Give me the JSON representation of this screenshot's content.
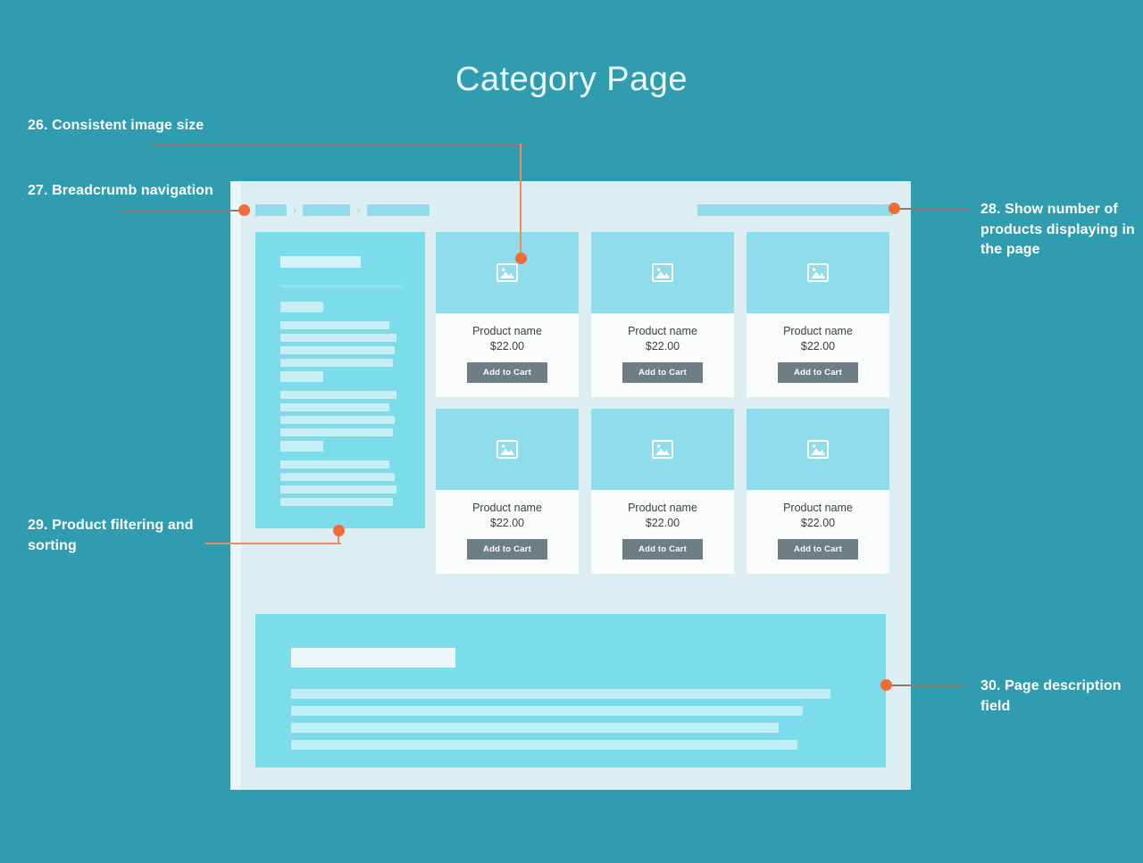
{
  "page": {
    "title": "Category Page",
    "background_color": "#309cb0",
    "accent_color": "#f26c35",
    "wireframe_bg": "#ddeef2",
    "panel_blue": "#7cdcea",
    "light_blue": "#8fdcea"
  },
  "topbar": {
    "breadcrumb": {
      "name": "breadcrumb-navigation",
      "separator": "›",
      "items": [
        "",
        "",
        ""
      ]
    },
    "product_count_bar": {
      "name": "product-count-bar",
      "value": ""
    }
  },
  "sidebar": {
    "name": "product-filter-sort-panel",
    "title_placeholder": "",
    "groups": [
      {
        "heading": "",
        "lines": [
          "",
          "",
          "",
          ""
        ]
      },
      {
        "heading": "",
        "lines": [
          "",
          "",
          "",
          ""
        ]
      },
      {
        "heading": "",
        "lines": [
          "",
          "",
          "",
          ""
        ]
      }
    ]
  },
  "products": {
    "icon_name": "image-placeholder-icon",
    "add_to_cart_label": "Add to Cart",
    "items": [
      {
        "name": "Product name",
        "price": "$22.00"
      },
      {
        "name": "Product name",
        "price": "$22.00"
      },
      {
        "name": "Product name",
        "price": "$22.00"
      },
      {
        "name": "Product name",
        "price": "$22.00"
      },
      {
        "name": "Product name",
        "price": "$22.00"
      },
      {
        "name": "Product name",
        "price": "$22.00"
      }
    ]
  },
  "description_field": {
    "name": "page-description-field",
    "title_placeholder": "",
    "lines": [
      "",
      "",
      "",
      ""
    ]
  },
  "annotations": [
    {
      "id": "26",
      "text": "26. Consistent image size"
    },
    {
      "id": "27",
      "text": "27. Breadcrumb navigation"
    },
    {
      "id": "28",
      "text": "28. Show number of products displaying in the page"
    },
    {
      "id": "29",
      "text": "29. Product filtering and sorting"
    },
    {
      "id": "30",
      "text": "30. Page description field"
    }
  ]
}
